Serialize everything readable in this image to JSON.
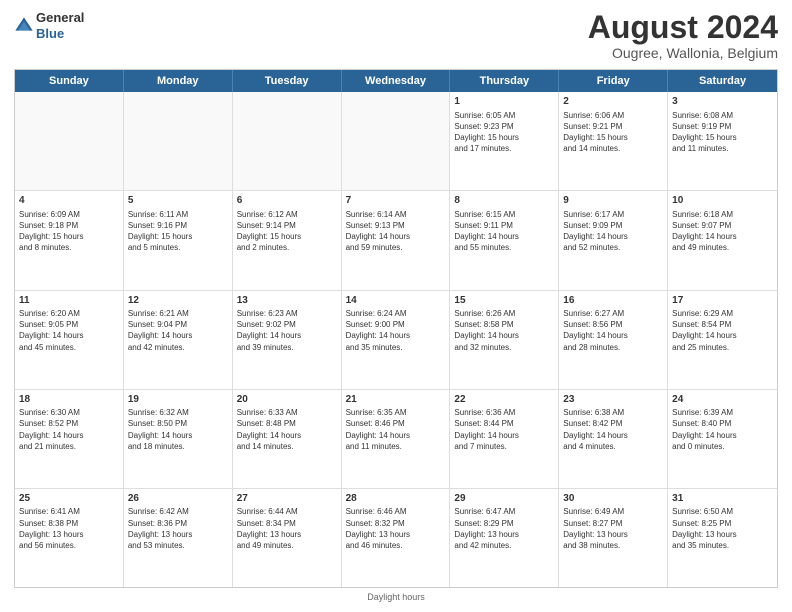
{
  "logo": {
    "line1": "General",
    "line2": "Blue"
  },
  "title": "August 2024",
  "subtitle": "Ougree, Wallonia, Belgium",
  "header_days": [
    "Sunday",
    "Monday",
    "Tuesday",
    "Wednesday",
    "Thursday",
    "Friday",
    "Saturday"
  ],
  "footer": "Daylight hours",
  "weeks": [
    [
      {
        "day": "",
        "info": ""
      },
      {
        "day": "",
        "info": ""
      },
      {
        "day": "",
        "info": ""
      },
      {
        "day": "",
        "info": ""
      },
      {
        "day": "1",
        "info": "Sunrise: 6:05 AM\nSunset: 9:23 PM\nDaylight: 15 hours\nand 17 minutes."
      },
      {
        "day": "2",
        "info": "Sunrise: 6:06 AM\nSunset: 9:21 PM\nDaylight: 15 hours\nand 14 minutes."
      },
      {
        "day": "3",
        "info": "Sunrise: 6:08 AM\nSunset: 9:19 PM\nDaylight: 15 hours\nand 11 minutes."
      }
    ],
    [
      {
        "day": "4",
        "info": "Sunrise: 6:09 AM\nSunset: 9:18 PM\nDaylight: 15 hours\nand 8 minutes."
      },
      {
        "day": "5",
        "info": "Sunrise: 6:11 AM\nSunset: 9:16 PM\nDaylight: 15 hours\nand 5 minutes."
      },
      {
        "day": "6",
        "info": "Sunrise: 6:12 AM\nSunset: 9:14 PM\nDaylight: 15 hours\nand 2 minutes."
      },
      {
        "day": "7",
        "info": "Sunrise: 6:14 AM\nSunset: 9:13 PM\nDaylight: 14 hours\nand 59 minutes."
      },
      {
        "day": "8",
        "info": "Sunrise: 6:15 AM\nSunset: 9:11 PM\nDaylight: 14 hours\nand 55 minutes."
      },
      {
        "day": "9",
        "info": "Sunrise: 6:17 AM\nSunset: 9:09 PM\nDaylight: 14 hours\nand 52 minutes."
      },
      {
        "day": "10",
        "info": "Sunrise: 6:18 AM\nSunset: 9:07 PM\nDaylight: 14 hours\nand 49 minutes."
      }
    ],
    [
      {
        "day": "11",
        "info": "Sunrise: 6:20 AM\nSunset: 9:05 PM\nDaylight: 14 hours\nand 45 minutes."
      },
      {
        "day": "12",
        "info": "Sunrise: 6:21 AM\nSunset: 9:04 PM\nDaylight: 14 hours\nand 42 minutes."
      },
      {
        "day": "13",
        "info": "Sunrise: 6:23 AM\nSunset: 9:02 PM\nDaylight: 14 hours\nand 39 minutes."
      },
      {
        "day": "14",
        "info": "Sunrise: 6:24 AM\nSunset: 9:00 PM\nDaylight: 14 hours\nand 35 minutes."
      },
      {
        "day": "15",
        "info": "Sunrise: 6:26 AM\nSunset: 8:58 PM\nDaylight: 14 hours\nand 32 minutes."
      },
      {
        "day": "16",
        "info": "Sunrise: 6:27 AM\nSunset: 8:56 PM\nDaylight: 14 hours\nand 28 minutes."
      },
      {
        "day": "17",
        "info": "Sunrise: 6:29 AM\nSunset: 8:54 PM\nDaylight: 14 hours\nand 25 minutes."
      }
    ],
    [
      {
        "day": "18",
        "info": "Sunrise: 6:30 AM\nSunset: 8:52 PM\nDaylight: 14 hours\nand 21 minutes."
      },
      {
        "day": "19",
        "info": "Sunrise: 6:32 AM\nSunset: 8:50 PM\nDaylight: 14 hours\nand 18 minutes."
      },
      {
        "day": "20",
        "info": "Sunrise: 6:33 AM\nSunset: 8:48 PM\nDaylight: 14 hours\nand 14 minutes."
      },
      {
        "day": "21",
        "info": "Sunrise: 6:35 AM\nSunset: 8:46 PM\nDaylight: 14 hours\nand 11 minutes."
      },
      {
        "day": "22",
        "info": "Sunrise: 6:36 AM\nSunset: 8:44 PM\nDaylight: 14 hours\nand 7 minutes."
      },
      {
        "day": "23",
        "info": "Sunrise: 6:38 AM\nSunset: 8:42 PM\nDaylight: 14 hours\nand 4 minutes."
      },
      {
        "day": "24",
        "info": "Sunrise: 6:39 AM\nSunset: 8:40 PM\nDaylight: 14 hours\nand 0 minutes."
      }
    ],
    [
      {
        "day": "25",
        "info": "Sunrise: 6:41 AM\nSunset: 8:38 PM\nDaylight: 13 hours\nand 56 minutes."
      },
      {
        "day": "26",
        "info": "Sunrise: 6:42 AM\nSunset: 8:36 PM\nDaylight: 13 hours\nand 53 minutes."
      },
      {
        "day": "27",
        "info": "Sunrise: 6:44 AM\nSunset: 8:34 PM\nDaylight: 13 hours\nand 49 minutes."
      },
      {
        "day": "28",
        "info": "Sunrise: 6:46 AM\nSunset: 8:32 PM\nDaylight: 13 hours\nand 46 minutes."
      },
      {
        "day": "29",
        "info": "Sunrise: 6:47 AM\nSunset: 8:29 PM\nDaylight: 13 hours\nand 42 minutes."
      },
      {
        "day": "30",
        "info": "Sunrise: 6:49 AM\nSunset: 8:27 PM\nDaylight: 13 hours\nand 38 minutes."
      },
      {
        "day": "31",
        "info": "Sunrise: 6:50 AM\nSunset: 8:25 PM\nDaylight: 13 hours\nand 35 minutes."
      }
    ]
  ]
}
